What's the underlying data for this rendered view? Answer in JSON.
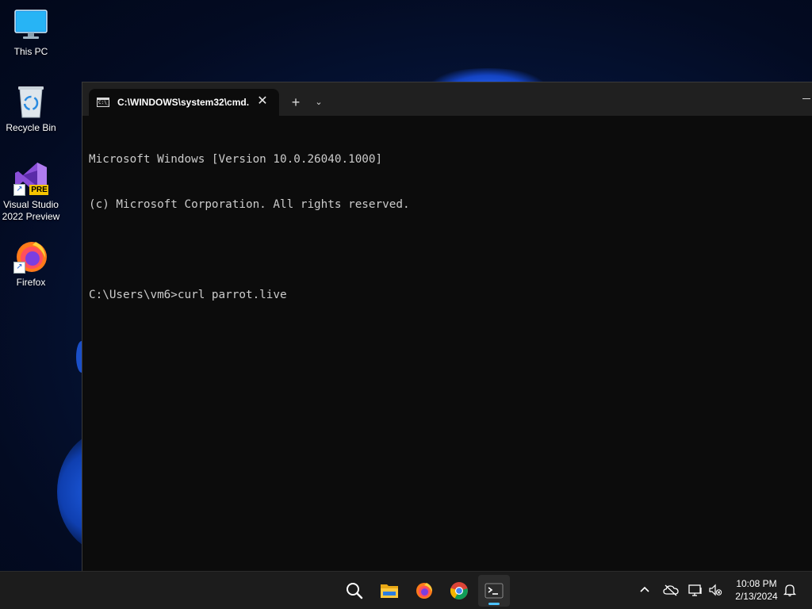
{
  "desktop": {
    "icons": [
      {
        "label": "This PC",
        "icon": "monitor-icon"
      },
      {
        "label": "Recycle Bin",
        "icon": "recycle-bin-icon"
      },
      {
        "label_line1": "Visual Studio",
        "label_line2": "2022 Preview",
        "icon": "visual-studio-icon",
        "badge": "PRE"
      },
      {
        "label": "Firefox",
        "icon": "firefox-icon"
      }
    ]
  },
  "terminal": {
    "tab_title": "C:\\WINDOWS\\system32\\cmd.",
    "tab_icon_text": "C:\\_",
    "new_tab_symbol": "+",
    "close_symbol": "✕",
    "dropdown_symbol": "⌄",
    "lines": [
      "Microsoft Windows [Version 10.0.26040.1000]",
      "(c) Microsoft Corporation. All rights reserved.",
      "",
      "C:\\Users\\vm6>curl parrot.live"
    ]
  },
  "taskbar": {
    "apps": [
      "search-icon",
      "file-explorer-icon",
      "firefox-icon",
      "chrome-icon",
      "terminal-icon"
    ],
    "tray": [
      "chevron-up-icon",
      "onedrive-offline-icon",
      "network-icon",
      "volume-muted-icon"
    ],
    "clock": {
      "time": "10:08 PM",
      "date": "2/13/2024"
    }
  },
  "colors": {
    "console_bg": "#0c0c0c",
    "console_text": "#cccccc",
    "titlebar_bg": "#202020",
    "taskbar_bg": "#1c1c1c",
    "accent": "#4cc2ff"
  }
}
